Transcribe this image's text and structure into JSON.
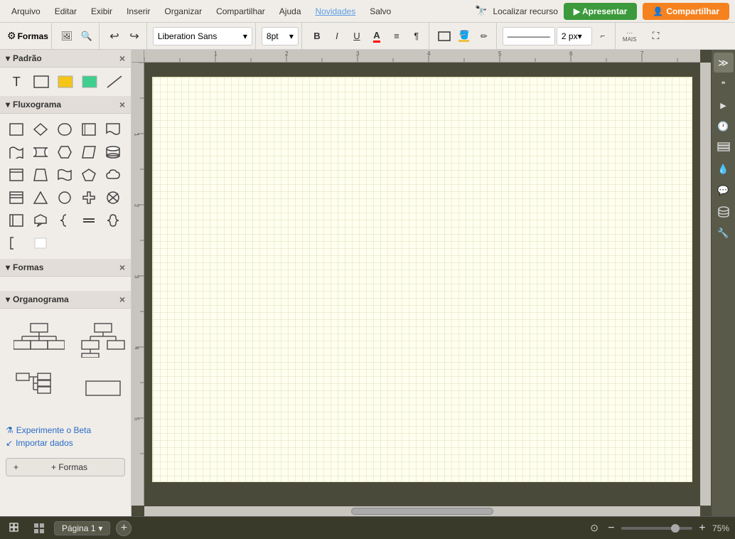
{
  "app": {
    "title": "Formas"
  },
  "menubar": {
    "items": [
      {
        "label": "Arquivo",
        "id": "arquivo"
      },
      {
        "label": "Editar",
        "id": "editar"
      },
      {
        "label": "Exibir",
        "id": "exibir"
      },
      {
        "label": "Inserir",
        "id": "inserir"
      },
      {
        "label": "Organizar",
        "id": "organizar"
      },
      {
        "label": "Compartilhar",
        "id": "compartilhar"
      },
      {
        "label": "Ajuda",
        "id": "ajuda"
      },
      {
        "label": "Novidades",
        "id": "novidades",
        "active": true
      },
      {
        "label": "Salvo",
        "id": "salvo"
      }
    ],
    "locate_resource": "Localizar recurso",
    "present_btn": "▶ Apresentar",
    "share_btn": "Compartilhar"
  },
  "toolbar": {
    "font_name": "Liberation Sans",
    "font_size": "8pt",
    "bold": "B",
    "italic": "I",
    "underline": "U",
    "font_color": "A",
    "align": "≡",
    "text_dir": "¶",
    "more_label": "MAIS",
    "stroke_width": "2 px"
  },
  "sidebar": {
    "shapes_label": "Formas",
    "panels": [
      {
        "id": "padrao",
        "label": "Padrão",
        "expanded": true
      },
      {
        "id": "fluxograma",
        "label": "Fluxograma",
        "expanded": true
      },
      {
        "id": "formas",
        "label": "Formas",
        "expanded": true
      },
      {
        "id": "organograma",
        "label": "Organograma",
        "expanded": true
      }
    ],
    "bottom_links": [
      {
        "label": "Experimente o Beta",
        "id": "beta"
      },
      {
        "label": "Importar dados",
        "id": "import"
      }
    ],
    "add_shapes_label": "+ Formas"
  },
  "bottombar": {
    "page_label": "Página 1",
    "zoom_percent": "75%",
    "zoom_minus": "−",
    "zoom_plus": "+"
  },
  "right_panel": {
    "icons": [
      {
        "name": "double-arrow-icon",
        "symbol": "≫"
      },
      {
        "name": "quote-icon",
        "symbol": "❝"
      },
      {
        "name": "video-icon",
        "symbol": "▶"
      },
      {
        "name": "clock-icon",
        "symbol": "🕐"
      },
      {
        "name": "layers-icon",
        "symbol": "◫"
      },
      {
        "name": "droplet-icon",
        "symbol": "💧"
      },
      {
        "name": "comment-icon",
        "symbol": "💬"
      },
      {
        "name": "database-icon",
        "symbol": "🗃"
      },
      {
        "name": "wrench-icon",
        "symbol": "🔧"
      }
    ]
  }
}
